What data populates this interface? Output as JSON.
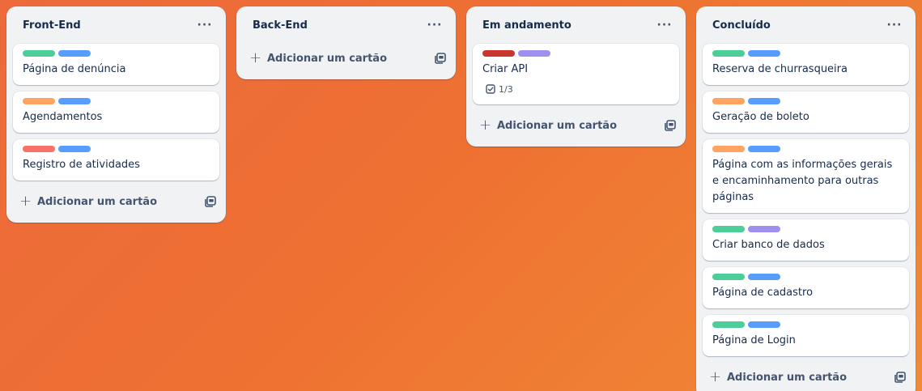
{
  "colors": {
    "green": "#4bce97",
    "blue": "#579dff",
    "orange": "#fea362",
    "red": "#f87168",
    "darkred": "#c9372c",
    "purple": "#9f8fef"
  },
  "lists": [
    {
      "title": "Front-End",
      "cards": [
        {
          "labels": [
            "green",
            "blue"
          ],
          "title": "Página de denúncia"
        },
        {
          "labels": [
            "orange",
            "blue"
          ],
          "title": "Agendamentos"
        },
        {
          "labels": [
            "red",
            "blue"
          ],
          "title": "Registro de atividades"
        }
      ],
      "add_label": "Adicionar um cartão"
    },
    {
      "title": "Back-End",
      "cards": [],
      "add_label": "Adicionar um cartão"
    },
    {
      "title": "Em andamento",
      "cards": [
        {
          "labels": [
            "darkred",
            "purple"
          ],
          "title": "Criar API",
          "checklist": "1/3"
        }
      ],
      "add_label": "Adicionar um cartão"
    },
    {
      "title": "Concluído",
      "cards": [
        {
          "labels": [
            "green",
            "blue"
          ],
          "title": "Reserva de churrasqueira"
        },
        {
          "labels": [
            "orange",
            "blue"
          ],
          "title": "Geração de boleto"
        },
        {
          "labels": [
            "orange",
            "blue"
          ],
          "title": "Página com as informações gerais e encaminhamento para outras páginas"
        },
        {
          "labels": [
            "green",
            "purple"
          ],
          "title": "Criar banco de dados"
        },
        {
          "labels": [
            "green",
            "blue"
          ],
          "title": "Página de cadastro"
        },
        {
          "labels": [
            "green",
            "blue"
          ],
          "title": "Página de Login"
        }
      ],
      "add_label": "Adicionar um cartão"
    }
  ],
  "icons": {
    "menu": "more-horizontal-icon",
    "add": "plus-icon",
    "template": "card-template-icon",
    "checklist": "checklist-icon"
  },
  "menu_glyph": "···",
  "plus_glyph": "+"
}
